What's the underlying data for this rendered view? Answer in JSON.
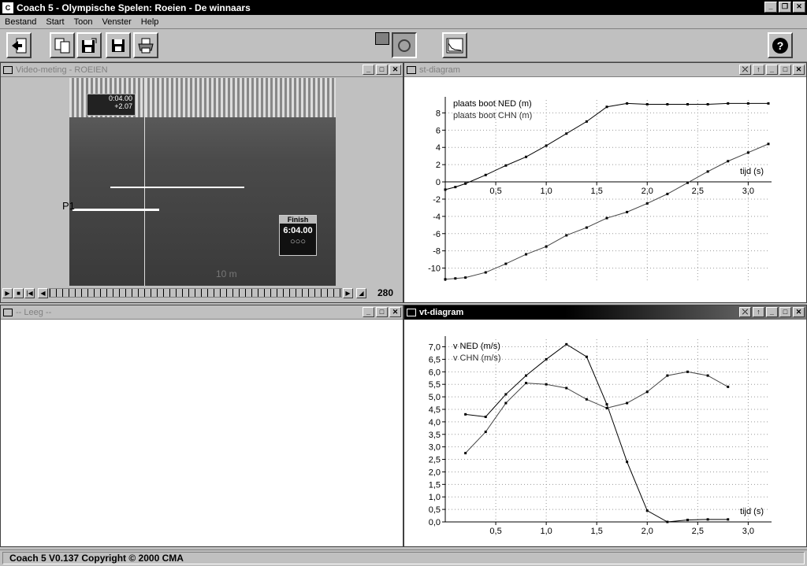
{
  "window": {
    "title": "Coach 5 - Olympische Spelen: Roeien - De winnaars"
  },
  "menu": [
    "Bestand",
    "Start",
    "Toon",
    "Venster",
    "Help"
  ],
  "toolbar": {
    "icons": [
      "exit-icon",
      "copy-icon",
      "save-as-icon",
      "save-icon",
      "print-icon",
      "video-tool-icon",
      "diagram-tool-icon",
      "help-icon"
    ]
  },
  "video_panel": {
    "title": "Video-meting - ROEIEN",
    "frame": "280",
    "marker_label": "P1",
    "overlay_time": "0:04.00",
    "overlay_diff": "+2.07",
    "finish_label": "Finish",
    "finish_time": "6:04.00",
    "distance_label": "10 m"
  },
  "empty_panel": {
    "title": "-- Leeg --"
  },
  "st_panel": {
    "title": "st-diagram"
  },
  "vt_panel": {
    "title": "vt-diagram"
  },
  "statusbar": {
    "text": "Coach 5 V0.137 Copyright © 2000 CMA"
  },
  "chart_data": [
    {
      "type": "line",
      "xlabel": "tijd (s)",
      "xlim": [
        0,
        3.2
      ],
      "ylim": [
        -11.5,
        9.5
      ],
      "xticks": [
        "0,5",
        "1,0",
        "1,5",
        "2,0",
        "2,5",
        "3,0"
      ],
      "yticks": [
        "8",
        "6",
        "4",
        "2",
        "0",
        "-2",
        "-4",
        "-6",
        "-8",
        "-10"
      ],
      "series": [
        {
          "name": "plaats boot NED (m)",
          "x": [
            0.0,
            0.1,
            0.2,
            0.4,
            0.6,
            0.8,
            1.0,
            1.2,
            1.4,
            1.6,
            1.8,
            2.0,
            2.2,
            2.4,
            2.6,
            2.8,
            3.0,
            3.2
          ],
          "y": [
            -0.9,
            -0.6,
            -0.2,
            0.8,
            1.9,
            2.9,
            4.2,
            5.6,
            7.0,
            8.7,
            9.1,
            9.0,
            9.0,
            9.0,
            9.0,
            9.1,
            9.1,
            9.1
          ]
        },
        {
          "name": "plaats boot CHN (m)",
          "x": [
            0.0,
            0.1,
            0.2,
            0.4,
            0.6,
            0.8,
            1.0,
            1.2,
            1.4,
            1.6,
            1.8,
            2.0,
            2.2,
            2.4,
            2.6,
            2.8,
            3.0,
            3.2
          ],
          "y": [
            -11.3,
            -11.2,
            -11.1,
            -10.5,
            -9.5,
            -8.4,
            -7.5,
            -6.2,
            -5.3,
            -4.2,
            -3.5,
            -2.5,
            -1.4,
            -0.1,
            1.2,
            2.4,
            3.4,
            4.4
          ]
        }
      ]
    },
    {
      "type": "line",
      "xlabel": "tijd (s)",
      "xlim": [
        0,
        3.2
      ],
      "ylim": [
        0,
        7.3
      ],
      "xticks": [
        "0,5",
        "1,0",
        "1,5",
        "2,0",
        "2,5",
        "3,0"
      ],
      "yticks": [
        "7,0",
        "6,5",
        "6,0",
        "5,5",
        "5,0",
        "4,5",
        "4,0",
        "3,5",
        "3,0",
        "2,5",
        "2,0",
        "1,5",
        "1,0",
        "0,5",
        "0,0"
      ],
      "series": [
        {
          "name": "v NED (m/s)",
          "x": [
            0.2,
            0.4,
            0.6,
            0.8,
            1.0,
            1.2,
            1.4,
            1.6,
            1.8,
            2.0,
            2.2,
            2.4,
            2.6,
            2.8
          ],
          "y": [
            4.3,
            4.2,
            5.1,
            5.85,
            6.5,
            7.1,
            6.6,
            4.7,
            2.4,
            0.45,
            0.0,
            0.08,
            0.1,
            0.1
          ]
        },
        {
          "name": "v CHN (m/s)",
          "x": [
            0.2,
            0.4,
            0.6,
            0.8,
            1.0,
            1.2,
            1.4,
            1.6,
            1.8,
            2.0,
            2.2,
            2.4,
            2.6,
            2.8
          ],
          "y": [
            2.75,
            3.6,
            4.75,
            5.55,
            5.5,
            5.35,
            4.9,
            4.55,
            4.75,
            5.2,
            5.85,
            6.0,
            5.85,
            5.4
          ]
        }
      ]
    }
  ]
}
